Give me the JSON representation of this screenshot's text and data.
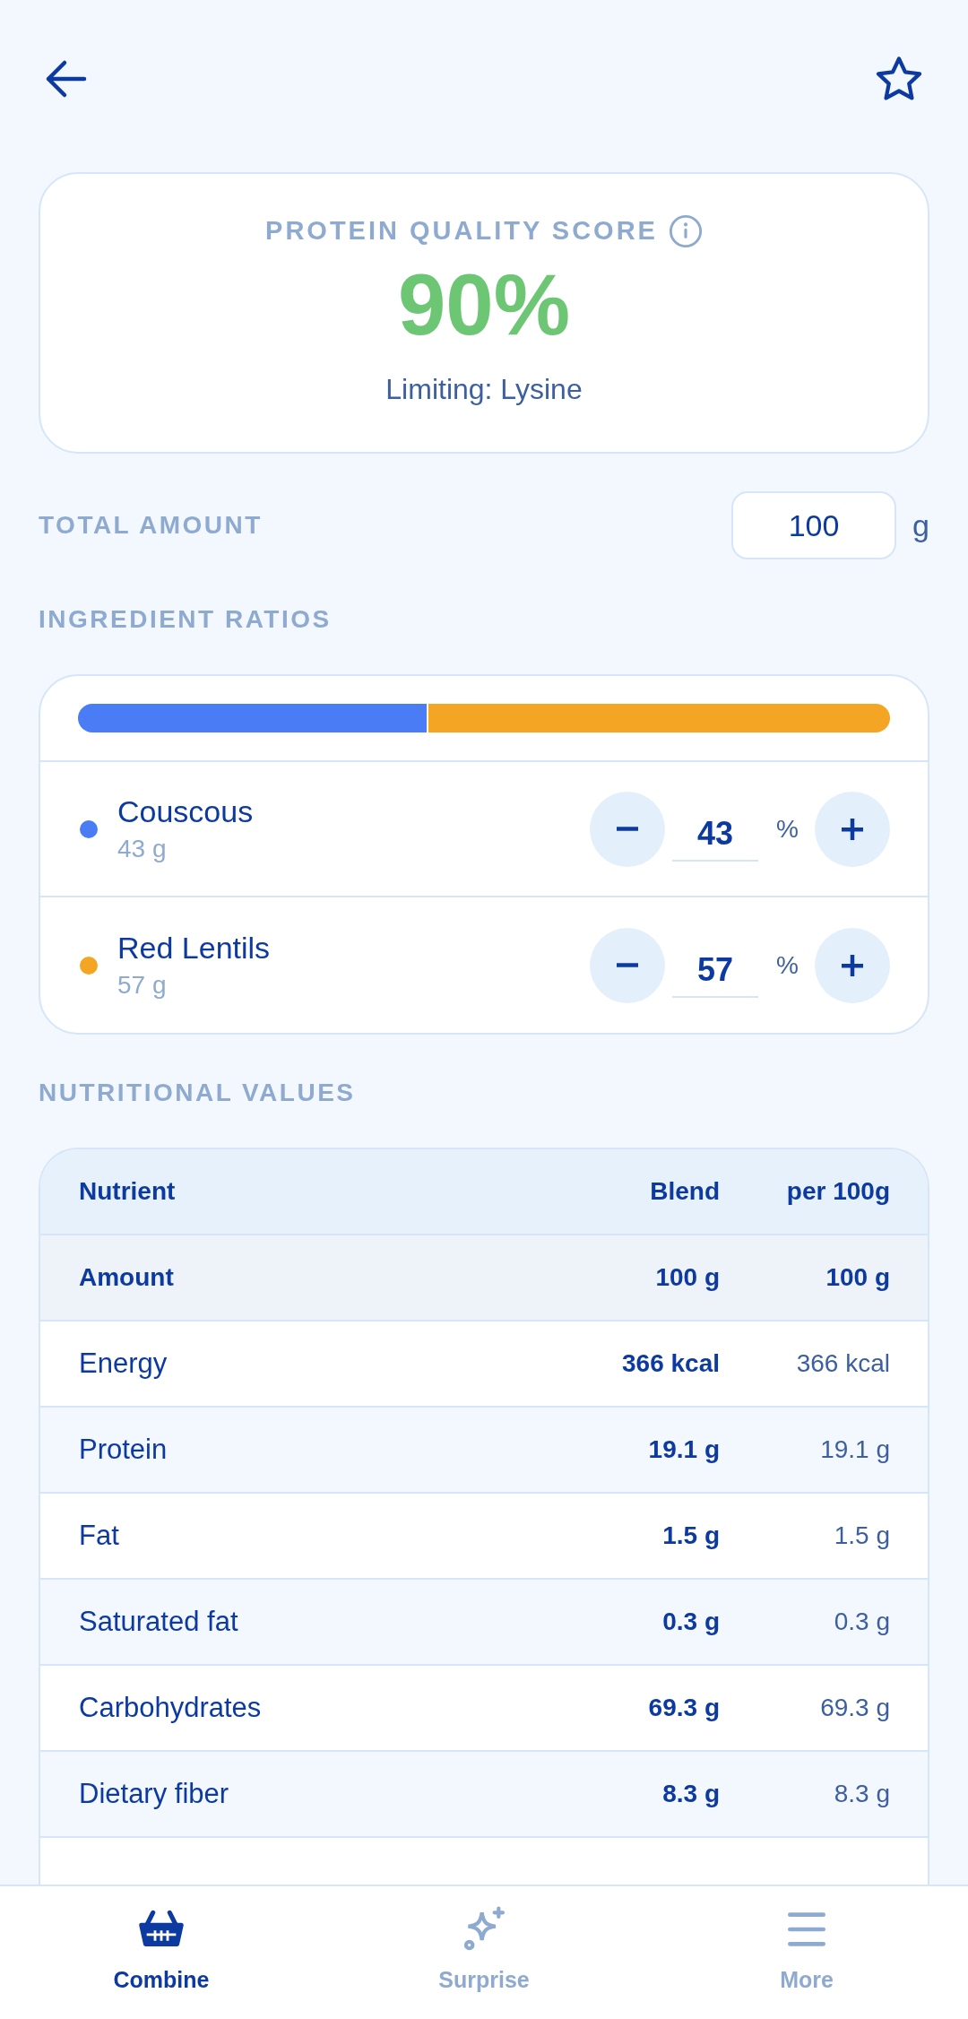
{
  "score_card": {
    "title": "PROTEIN QUALITY SCORE",
    "score": "90%",
    "subtitle": "Limiting: Lysine"
  },
  "total_amount": {
    "label": "TOTAL AMOUNT",
    "value": "100",
    "unit": "g"
  },
  "ratios_heading": "INGREDIENT RATIOS",
  "ingredients": [
    {
      "name": "Couscous",
      "amount": "43 g",
      "percent": "43",
      "unit": "%",
      "color": "#4a7cf5"
    },
    {
      "name": "Red Lentils",
      "amount": "57 g",
      "percent": "57",
      "unit": "%",
      "color": "#f4a523"
    }
  ],
  "nutrition_heading": "NUTRITIONAL VALUES",
  "table": {
    "columns": [
      "Nutrient",
      "Blend",
      "per 100g"
    ],
    "rows": [
      {
        "kind": "summary",
        "cells": [
          "Amount",
          "100 g",
          "100 g"
        ]
      },
      {
        "kind": "data",
        "cells": [
          "Energy",
          "366 kcal",
          "366 kcal"
        ]
      },
      {
        "kind": "data",
        "cells": [
          "Protein",
          "19.1 g",
          "19.1 g"
        ]
      },
      {
        "kind": "data",
        "cells": [
          "Fat",
          "1.5 g",
          "1.5 g"
        ]
      },
      {
        "kind": "data",
        "cells": [
          "Saturated fat",
          "0.3 g",
          "0.3 g"
        ]
      },
      {
        "kind": "data",
        "cells": [
          "Carbohydrates",
          "69.3 g",
          "69.3 g"
        ]
      },
      {
        "kind": "data",
        "cells": [
          "Dietary fiber",
          "8.3 g",
          "8.3 g"
        ]
      }
    ]
  },
  "nav": [
    {
      "label": "Combine",
      "selected": true
    },
    {
      "label": "Surprise",
      "selected": false
    },
    {
      "label": "More",
      "selected": false
    }
  ]
}
